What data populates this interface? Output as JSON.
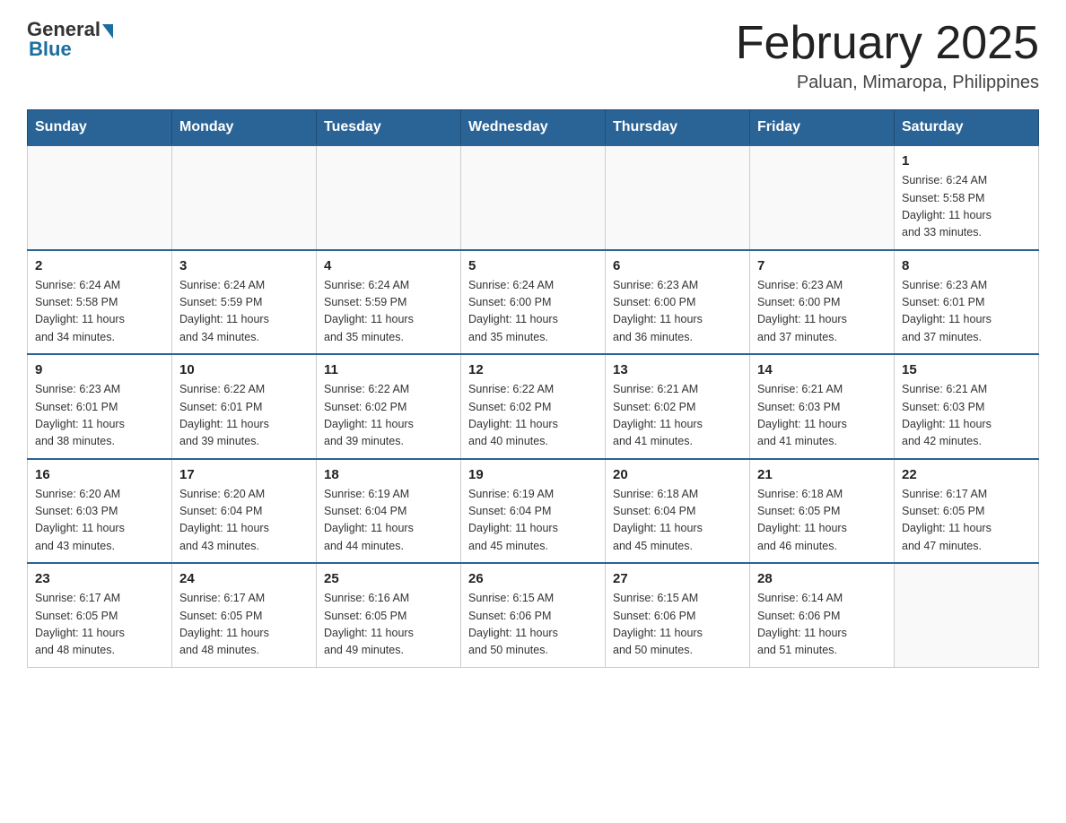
{
  "header": {
    "logo_general": "General",
    "logo_blue": "Blue",
    "title": "February 2025",
    "location": "Paluan, Mimaropa, Philippines"
  },
  "days_of_week": [
    "Sunday",
    "Monday",
    "Tuesday",
    "Wednesday",
    "Thursday",
    "Friday",
    "Saturday"
  ],
  "weeks": [
    {
      "days": [
        {
          "num": "",
          "info": ""
        },
        {
          "num": "",
          "info": ""
        },
        {
          "num": "",
          "info": ""
        },
        {
          "num": "",
          "info": ""
        },
        {
          "num": "",
          "info": ""
        },
        {
          "num": "",
          "info": ""
        },
        {
          "num": "1",
          "info": "Sunrise: 6:24 AM\nSunset: 5:58 PM\nDaylight: 11 hours\nand 33 minutes."
        }
      ]
    },
    {
      "days": [
        {
          "num": "2",
          "info": "Sunrise: 6:24 AM\nSunset: 5:58 PM\nDaylight: 11 hours\nand 34 minutes."
        },
        {
          "num": "3",
          "info": "Sunrise: 6:24 AM\nSunset: 5:59 PM\nDaylight: 11 hours\nand 34 minutes."
        },
        {
          "num": "4",
          "info": "Sunrise: 6:24 AM\nSunset: 5:59 PM\nDaylight: 11 hours\nand 35 minutes."
        },
        {
          "num": "5",
          "info": "Sunrise: 6:24 AM\nSunset: 6:00 PM\nDaylight: 11 hours\nand 35 minutes."
        },
        {
          "num": "6",
          "info": "Sunrise: 6:23 AM\nSunset: 6:00 PM\nDaylight: 11 hours\nand 36 minutes."
        },
        {
          "num": "7",
          "info": "Sunrise: 6:23 AM\nSunset: 6:00 PM\nDaylight: 11 hours\nand 37 minutes."
        },
        {
          "num": "8",
          "info": "Sunrise: 6:23 AM\nSunset: 6:01 PM\nDaylight: 11 hours\nand 37 minutes."
        }
      ]
    },
    {
      "days": [
        {
          "num": "9",
          "info": "Sunrise: 6:23 AM\nSunset: 6:01 PM\nDaylight: 11 hours\nand 38 minutes."
        },
        {
          "num": "10",
          "info": "Sunrise: 6:22 AM\nSunset: 6:01 PM\nDaylight: 11 hours\nand 39 minutes."
        },
        {
          "num": "11",
          "info": "Sunrise: 6:22 AM\nSunset: 6:02 PM\nDaylight: 11 hours\nand 39 minutes."
        },
        {
          "num": "12",
          "info": "Sunrise: 6:22 AM\nSunset: 6:02 PM\nDaylight: 11 hours\nand 40 minutes."
        },
        {
          "num": "13",
          "info": "Sunrise: 6:21 AM\nSunset: 6:02 PM\nDaylight: 11 hours\nand 41 minutes."
        },
        {
          "num": "14",
          "info": "Sunrise: 6:21 AM\nSunset: 6:03 PM\nDaylight: 11 hours\nand 41 minutes."
        },
        {
          "num": "15",
          "info": "Sunrise: 6:21 AM\nSunset: 6:03 PM\nDaylight: 11 hours\nand 42 minutes."
        }
      ]
    },
    {
      "days": [
        {
          "num": "16",
          "info": "Sunrise: 6:20 AM\nSunset: 6:03 PM\nDaylight: 11 hours\nand 43 minutes."
        },
        {
          "num": "17",
          "info": "Sunrise: 6:20 AM\nSunset: 6:04 PM\nDaylight: 11 hours\nand 43 minutes."
        },
        {
          "num": "18",
          "info": "Sunrise: 6:19 AM\nSunset: 6:04 PM\nDaylight: 11 hours\nand 44 minutes."
        },
        {
          "num": "19",
          "info": "Sunrise: 6:19 AM\nSunset: 6:04 PM\nDaylight: 11 hours\nand 45 minutes."
        },
        {
          "num": "20",
          "info": "Sunrise: 6:18 AM\nSunset: 6:04 PM\nDaylight: 11 hours\nand 45 minutes."
        },
        {
          "num": "21",
          "info": "Sunrise: 6:18 AM\nSunset: 6:05 PM\nDaylight: 11 hours\nand 46 minutes."
        },
        {
          "num": "22",
          "info": "Sunrise: 6:17 AM\nSunset: 6:05 PM\nDaylight: 11 hours\nand 47 minutes."
        }
      ]
    },
    {
      "days": [
        {
          "num": "23",
          "info": "Sunrise: 6:17 AM\nSunset: 6:05 PM\nDaylight: 11 hours\nand 48 minutes."
        },
        {
          "num": "24",
          "info": "Sunrise: 6:17 AM\nSunset: 6:05 PM\nDaylight: 11 hours\nand 48 minutes."
        },
        {
          "num": "25",
          "info": "Sunrise: 6:16 AM\nSunset: 6:05 PM\nDaylight: 11 hours\nand 49 minutes."
        },
        {
          "num": "26",
          "info": "Sunrise: 6:15 AM\nSunset: 6:06 PM\nDaylight: 11 hours\nand 50 minutes."
        },
        {
          "num": "27",
          "info": "Sunrise: 6:15 AM\nSunset: 6:06 PM\nDaylight: 11 hours\nand 50 minutes."
        },
        {
          "num": "28",
          "info": "Sunrise: 6:14 AM\nSunset: 6:06 PM\nDaylight: 11 hours\nand 51 minutes."
        },
        {
          "num": "",
          "info": ""
        }
      ]
    }
  ]
}
